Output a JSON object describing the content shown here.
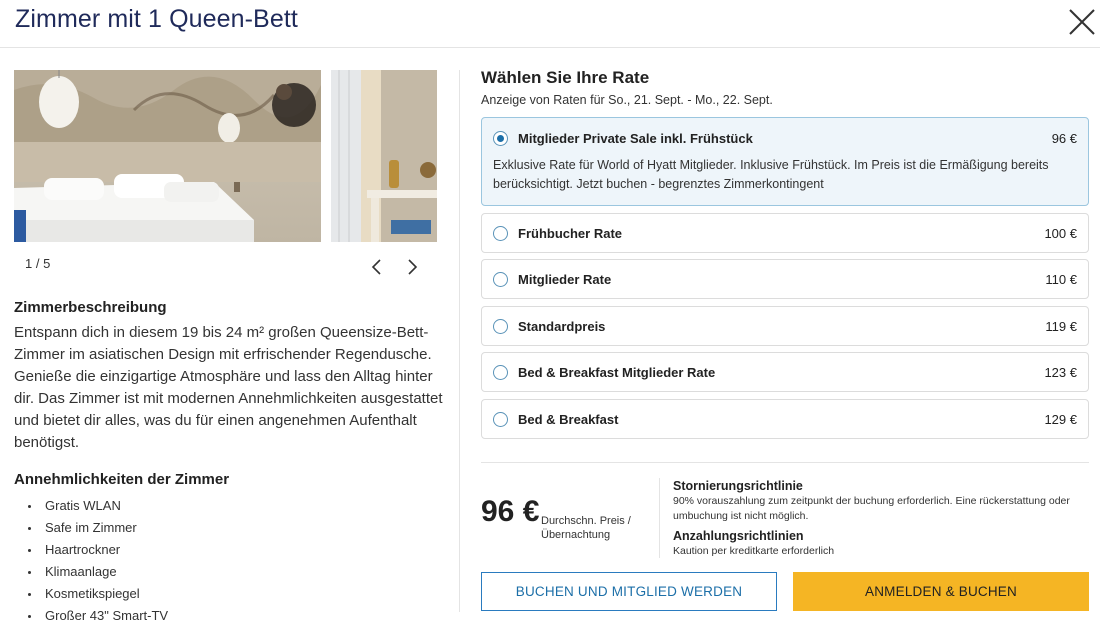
{
  "header": {
    "title": "Zimmer mit 1 Queen-Bett"
  },
  "gallery": {
    "counter": "1 / 5"
  },
  "description": {
    "heading": "Zimmerbeschreibung",
    "text": "Entspann dich in diesem 19 bis 24 m² großen Queensize-Bett-Zimmer im asiatischen Design mit erfrischender Regendusche. Genieße die einzigartige Atmosphäre und lass den Alltag hinter dir. Das Zimmer ist mit modernen Annehmlichkeiten ausgestattet und bietet dir alles, was du für einen angenehmen Aufenthalt benötigst."
  },
  "amenities": {
    "heading": "Annehmlichkeiten der Zimmer",
    "items": [
      "Gratis WLAN",
      "Safe im Zimmer",
      "Haartrockner",
      "Klimaanlage",
      "Kosmetikspiegel",
      "Großer 43\" Smart-TV"
    ]
  },
  "rates": {
    "heading": "Wählen Sie Ihre Rate",
    "subheading": "Anzeige von Raten für So., 21. Sept. - Mo., 22. Sept.",
    "options": [
      {
        "name": "Mitglieder Private Sale inkl. Frühstück",
        "price": "96 €",
        "selected": true,
        "detail": "Exklusive Rate für World of Hyatt Mitglieder. Inklusive Frühstück. Im Preis ist die Ermäßigung bereits berücksichtigt. Jetzt buchen - begrenztes Zimmerkontingent"
      },
      {
        "name": "Frühbucher Rate",
        "price": "100 €",
        "selected": false
      },
      {
        "name": "Mitglieder Rate",
        "price": "110 €",
        "selected": false
      },
      {
        "name": "Standardpreis",
        "price": "119 €",
        "selected": false
      },
      {
        "name": "Bed & Breakfast Mitglieder Rate",
        "price": "123 €",
        "selected": false
      },
      {
        "name": "Bed & Breakfast",
        "price": "129 €",
        "selected": false
      }
    ]
  },
  "summary": {
    "price": "96 €",
    "price_note": "Durchschn. Preis / Übernachtung",
    "cancellation_heading": "Stornierungsrichtlinie",
    "cancellation_text": "90% vorauszahlung zum zeitpunkt der buchung erforderlich. Eine rückerstattung oder umbuchung ist nicht möglich.",
    "deposit_heading": "Anzahlungsrichtlinien",
    "deposit_text": "Kaution per kreditkarte erforderlich"
  },
  "actions": {
    "book_join": "BUCHEN UND MITGLIED WERDEN",
    "login_book": "ANMELDEN & BUCHEN"
  },
  "colors": {
    "title": "#1f2a5a",
    "accent_blue": "#1c6fa8",
    "selected_bg": "#eef5fa",
    "cta_yellow": "#f5b524"
  }
}
